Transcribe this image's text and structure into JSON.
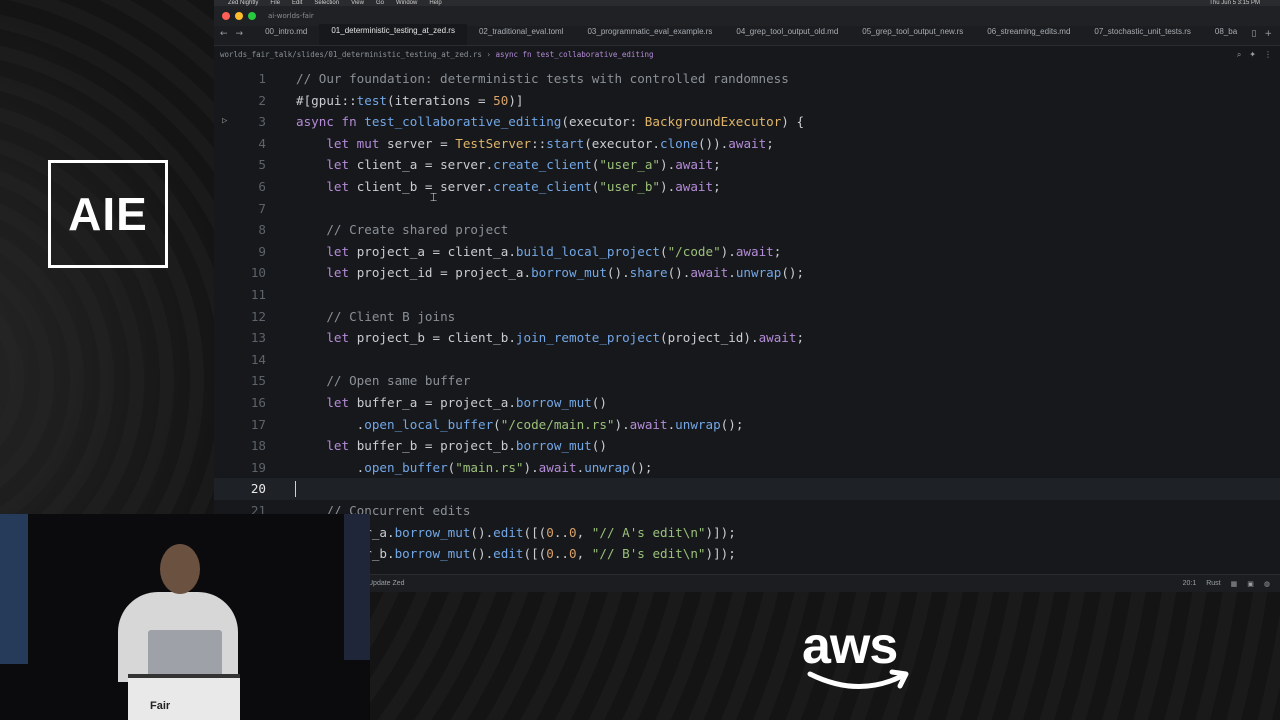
{
  "stage": {
    "logo_text": "AIE",
    "sponsor_text": "aws"
  },
  "menubar": {
    "items": [
      "Zed Nightly",
      "File",
      "Edit",
      "Selection",
      "View",
      "Go",
      "Window",
      "Help"
    ],
    "clock": "Thu Jun 5  3:15 PM"
  },
  "titlebar": {
    "project": "ai-worlds-fair"
  },
  "tabs": [
    {
      "label": "00_intro.md",
      "active": false
    },
    {
      "label": "01_deterministic_testing_at_zed.rs",
      "active": true
    },
    {
      "label": "02_traditional_eval.toml",
      "active": false
    },
    {
      "label": "03_programmatic_eval_example.rs",
      "active": false
    },
    {
      "label": "04_grep_tool_output_old.md",
      "active": false
    },
    {
      "label": "05_grep_tool_output_new.rs",
      "active": false
    },
    {
      "label": "06_streaming_edits.md",
      "active": false
    },
    {
      "label": "07_stochastic_unit_tests.rs",
      "active": false
    },
    {
      "label": "08_ba",
      "active": false
    }
  ],
  "breadcrumb": {
    "path": "worlds_fair_talk/slides/01_deterministic_testing_at_zed.rs",
    "symbol": "async fn test_collaborative_editing"
  },
  "editor": {
    "current_line": 20,
    "lines": [
      {
        "n": "1",
        "tokens": [
          [
            "c",
            "// Our foundation: deterministic tests with controlled randomness"
          ]
        ]
      },
      {
        "n": "2",
        "tokens": [
          [
            "p",
            "#[gpui::"
          ],
          [
            "f",
            "test"
          ],
          [
            "p",
            "(iterations = "
          ],
          [
            "num",
            "50"
          ],
          [
            "p",
            ")]"
          ]
        ]
      },
      {
        "n": "3",
        "run": true,
        "tokens": [
          [
            "k",
            "async fn "
          ],
          [
            "f",
            "test_collaborative_editing"
          ],
          [
            "p",
            "(executor: "
          ],
          [
            "t",
            "BackgroundExecutor"
          ],
          [
            "p",
            ") {"
          ]
        ]
      },
      {
        "n": "4",
        "tokens": [
          [
            "p",
            "    "
          ],
          [
            "k",
            "let mut "
          ],
          [
            "p",
            "server = "
          ],
          [
            "t",
            "TestServer"
          ],
          [
            "p",
            "::"
          ],
          [
            "f",
            "start"
          ],
          [
            "p",
            "(executor."
          ],
          [
            "f",
            "clone"
          ],
          [
            "p",
            "())."
          ],
          [
            "k",
            "await"
          ],
          [
            "p",
            ";"
          ]
        ]
      },
      {
        "n": "5",
        "tokens": [
          [
            "p",
            "    "
          ],
          [
            "k",
            "let "
          ],
          [
            "p",
            "client_a = server."
          ],
          [
            "f",
            "create_client"
          ],
          [
            "p",
            "("
          ],
          [
            "s",
            "\"user_a\""
          ],
          [
            "p",
            ")."
          ],
          [
            "k",
            "await"
          ],
          [
            "p",
            ";"
          ]
        ]
      },
      {
        "n": "6",
        "tokens": [
          [
            "p",
            "    "
          ],
          [
            "k",
            "let "
          ],
          [
            "p",
            "client_b = server."
          ],
          [
            "f",
            "create_client"
          ],
          [
            "p",
            "("
          ],
          [
            "s",
            "\"user_b\""
          ],
          [
            "p",
            ")."
          ],
          [
            "k",
            "await"
          ],
          [
            "p",
            ";"
          ]
        ]
      },
      {
        "n": "7",
        "tokens": []
      },
      {
        "n": "8",
        "tokens": [
          [
            "p",
            "    "
          ],
          [
            "c",
            "// Create shared project"
          ]
        ]
      },
      {
        "n": "9",
        "tokens": [
          [
            "p",
            "    "
          ],
          [
            "k",
            "let "
          ],
          [
            "p",
            "project_a = client_a."
          ],
          [
            "f",
            "build_local_project"
          ],
          [
            "p",
            "("
          ],
          [
            "s",
            "\"/code\""
          ],
          [
            "p",
            ")."
          ],
          [
            "k",
            "await"
          ],
          [
            "p",
            ";"
          ]
        ]
      },
      {
        "n": "10",
        "tokens": [
          [
            "p",
            "    "
          ],
          [
            "k",
            "let "
          ],
          [
            "p",
            "project_id = project_a."
          ],
          [
            "f",
            "borrow_mut"
          ],
          [
            "p",
            "()."
          ],
          [
            "f",
            "share"
          ],
          [
            "p",
            "()."
          ],
          [
            "k",
            "await"
          ],
          [
            "p",
            "."
          ],
          [
            "f",
            "unwrap"
          ],
          [
            "p",
            "();"
          ]
        ]
      },
      {
        "n": "11",
        "tokens": []
      },
      {
        "n": "12",
        "tokens": [
          [
            "p",
            "    "
          ],
          [
            "c",
            "// Client B joins"
          ]
        ]
      },
      {
        "n": "13",
        "tokens": [
          [
            "p",
            "    "
          ],
          [
            "k",
            "let "
          ],
          [
            "p",
            "project_b = client_b."
          ],
          [
            "f",
            "join_remote_project"
          ],
          [
            "p",
            "(project_id)."
          ],
          [
            "k",
            "await"
          ],
          [
            "p",
            ";"
          ]
        ]
      },
      {
        "n": "14",
        "tokens": []
      },
      {
        "n": "15",
        "tokens": [
          [
            "p",
            "    "
          ],
          [
            "c",
            "// Open same buffer"
          ]
        ]
      },
      {
        "n": "16",
        "tokens": [
          [
            "p",
            "    "
          ],
          [
            "k",
            "let "
          ],
          [
            "p",
            "buffer_a = project_a."
          ],
          [
            "f",
            "borrow_mut"
          ],
          [
            "p",
            "()"
          ]
        ]
      },
      {
        "n": "17",
        "tokens": [
          [
            "p",
            "        ."
          ],
          [
            "f",
            "open_local_buffer"
          ],
          [
            "p",
            "("
          ],
          [
            "s",
            "\"/code/main.rs\""
          ],
          [
            "p",
            ")."
          ],
          [
            "k",
            "await"
          ],
          [
            "p",
            "."
          ],
          [
            "f",
            "unwrap"
          ],
          [
            "p",
            "();"
          ]
        ]
      },
      {
        "n": "18",
        "tokens": [
          [
            "p",
            "    "
          ],
          [
            "k",
            "let "
          ],
          [
            "p",
            "buffer_b = project_b."
          ],
          [
            "f",
            "borrow_mut"
          ],
          [
            "p",
            "()"
          ]
        ]
      },
      {
        "n": "19",
        "tokens": [
          [
            "p",
            "        ."
          ],
          [
            "f",
            "open_buffer"
          ],
          [
            "p",
            "("
          ],
          [
            "s",
            "\"main.rs\""
          ],
          [
            "p",
            ")."
          ],
          [
            "k",
            "await"
          ],
          [
            "p",
            "."
          ],
          [
            "f",
            "unwrap"
          ],
          [
            "p",
            "();"
          ]
        ]
      },
      {
        "n": "20",
        "tokens": []
      },
      {
        "n": "21",
        "tokens": [
          [
            "p",
            "    "
          ],
          [
            "c",
            "// Concurrent edits"
          ]
        ]
      },
      {
        "n": "22",
        "tokens": [
          [
            "p",
            "    buffer_a."
          ],
          [
            "f",
            "borrow_mut"
          ],
          [
            "p",
            "()."
          ],
          [
            "f",
            "edit"
          ],
          [
            "p",
            "([("
          ],
          [
            "num",
            "0"
          ],
          [
            "p",
            ".."
          ],
          [
            "num",
            "0"
          ],
          [
            "p",
            ", "
          ],
          [
            "s",
            "\"// A's edit\\n\""
          ],
          [
            "p",
            ")]);"
          ]
        ]
      },
      {
        "n": "23",
        "tokens": [
          [
            "p",
            "    buffer_b."
          ],
          [
            "f",
            "borrow_mut"
          ],
          [
            "p",
            "()."
          ],
          [
            "f",
            "edit"
          ],
          [
            "p",
            "([("
          ],
          [
            "num",
            "0"
          ],
          [
            "p",
            ".."
          ],
          [
            "num",
            "0"
          ],
          [
            "p",
            ", "
          ],
          [
            "s",
            "\"// B's edit\\n\""
          ],
          [
            "p",
            ")]);"
          ]
        ]
      }
    ]
  },
  "statusbar": {
    "update_text": "Update Zed",
    "position": "20:1",
    "language": "Rust"
  },
  "inset": {
    "podium_label": "Fair"
  },
  "colors": {
    "comment": "#8b9097",
    "keyword": "#b58cd8",
    "function": "#73a7e6",
    "string": "#9bc07a",
    "number": "#d8a26a",
    "type": "#e0b56a"
  }
}
